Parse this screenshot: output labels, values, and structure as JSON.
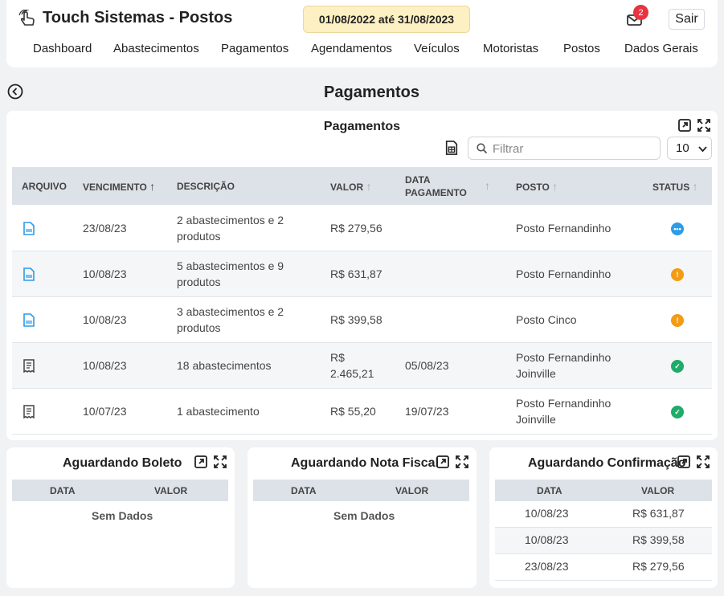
{
  "app": {
    "title": "Touch Sistemas - Postos",
    "date_range": "01/08/2022 até 31/08/2023",
    "notifications": "2",
    "logout": "Sair"
  },
  "nav": [
    "Dashboard",
    "Abastecimentos",
    "Pagamentos",
    "Agendamentos",
    "Veículos",
    "Motoristas",
    "Postos",
    "Dados Gerais"
  ],
  "page": {
    "title": "Pagamentos"
  },
  "payments": {
    "title": "Pagamentos",
    "filter_placeholder": "Filtrar",
    "page_size": "10",
    "columns": {
      "arquivo": "ARQUIVO",
      "vencimento": "VENCIMENTO",
      "descricao": "DESCRIÇÃO",
      "valor": "VALOR",
      "data_pagamento_1": "DATA",
      "data_pagamento_2": "PAGAMENTO",
      "posto": "POSTO",
      "status": "STATUS"
    },
    "rows": [
      {
        "file_icon": "boleto-icon",
        "vencimento": "23/08/23",
        "descricao_1": "2 abastecimentos e 2",
        "descricao_2": "produtos",
        "valor_1": "R$ 279,56",
        "valor_2": "",
        "data_pagamento": "",
        "posto_1": "Posto Fernandinho",
        "posto_2": "",
        "status": "pending",
        "status_color": "#2d9be8"
      },
      {
        "file_icon": "boleto-icon",
        "vencimento": "10/08/23",
        "descricao_1": "5 abastecimentos e 9",
        "descricao_2": "produtos",
        "valor_1": "R$ 631,87",
        "valor_2": "",
        "data_pagamento": "",
        "posto_1": "Posto Fernandinho",
        "posto_2": "",
        "status": "warning",
        "status_color": "#f39c12"
      },
      {
        "file_icon": "boleto-icon",
        "vencimento": "10/08/23",
        "descricao_1": "3 abastecimentos e 2",
        "descricao_2": "produtos",
        "valor_1": "R$ 399,58",
        "valor_2": "",
        "data_pagamento": "",
        "posto_1": "Posto Cinco",
        "posto_2": "",
        "status": "warning",
        "status_color": "#f39c12"
      },
      {
        "file_icon": "receipt-icon",
        "vencimento": "10/08/23",
        "descricao_1": "18 abastecimentos",
        "descricao_2": "",
        "valor_1": "R$",
        "valor_2": "2.465,21",
        "data_pagamento": "05/08/23",
        "posto_1": "Posto Fernandinho",
        "posto_2": "Joinville",
        "status": "paid",
        "status_color": "#1fab6a"
      },
      {
        "file_icon": "receipt-icon",
        "vencimento": "10/07/23",
        "descricao_1": "1 abastecimento",
        "descricao_2": "",
        "valor_1": "R$ 55,20",
        "valor_2": "",
        "data_pagamento": "19/07/23",
        "posto_1": "Posto Fernandinho",
        "posto_2": "Joinville",
        "status": "paid",
        "status_color": "#1fab6a"
      }
    ]
  },
  "small_cards": [
    {
      "title": "Aguardando Boleto",
      "col_data": "DATA",
      "col_valor": "VALOR",
      "empty": "Sem Dados",
      "rows": []
    },
    {
      "title": "Aguardando Nota Fiscal",
      "col_data": "DATA",
      "col_valor": "VALOR",
      "empty": "Sem Dados",
      "rows": []
    },
    {
      "title": "Aguardando Confirmação",
      "col_data": "DATA",
      "col_valor": "VALOR",
      "empty": "",
      "rows": [
        {
          "data": "10/08/23",
          "valor": "R$ 631,87"
        },
        {
          "data": "10/08/23",
          "valor": "R$ 399,58"
        },
        {
          "data": "23/08/23",
          "valor": "R$ 279,56"
        }
      ]
    }
  ]
}
